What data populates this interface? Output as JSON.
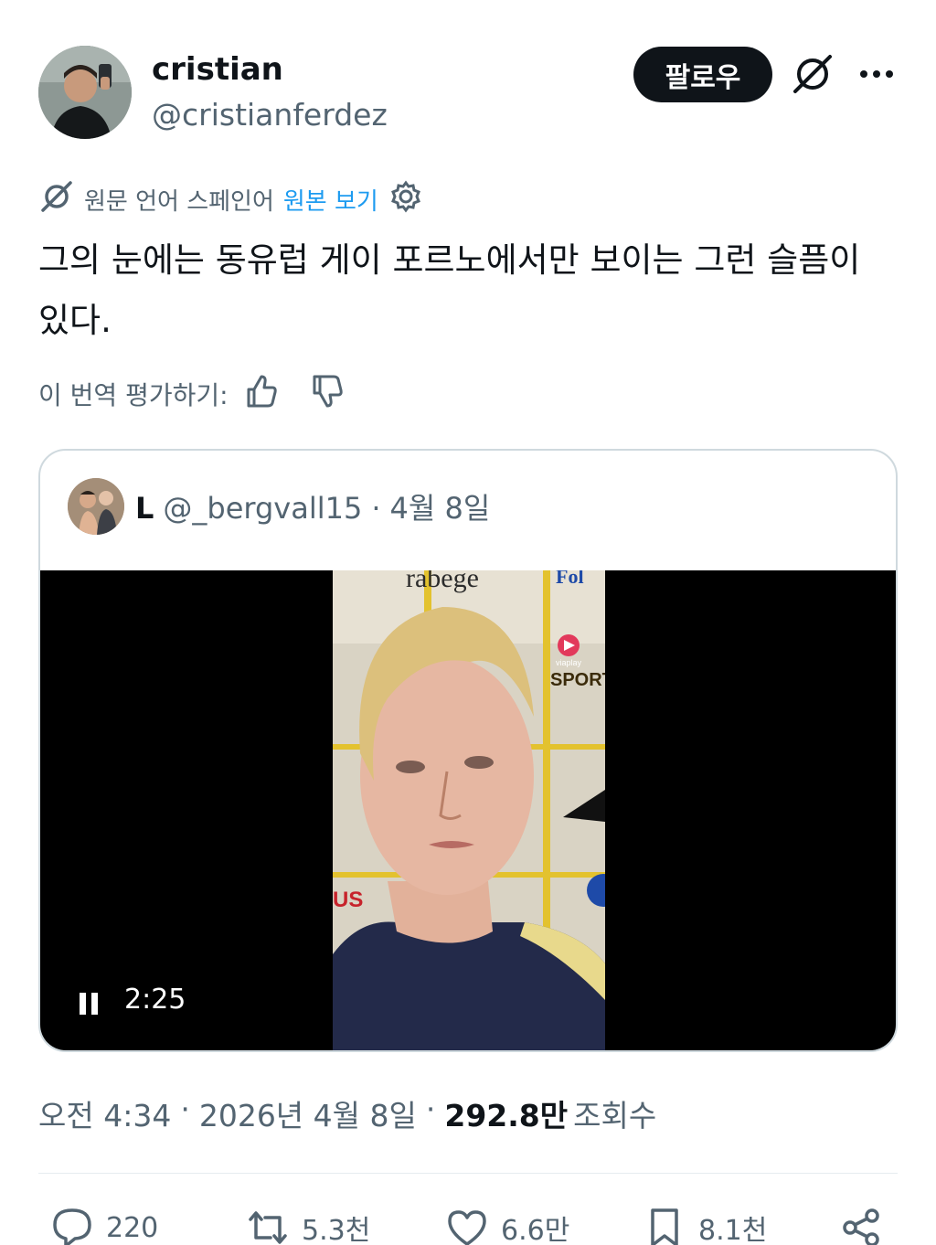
{
  "author": {
    "display_name": "cristian",
    "handle": "@cristianferdez",
    "follow_label": "팔로우"
  },
  "translation": {
    "notice": "원문 언어 스페인어",
    "view_original": "원본 보기"
  },
  "tweet": {
    "text": "그의 눈에는 동유럽 게이 포르노에서만 보이는 그런 슬픔이 있다."
  },
  "rating": {
    "label": "이 번역 평가하기:"
  },
  "quote": {
    "name": "L",
    "handle": "@_bergvall15",
    "separator": "·",
    "date": "4월 8일",
    "video_time": "2:25",
    "video_overlay": {
      "backdrop_text_1": "rabege",
      "backdrop_text_2": "Fol",
      "sponsor_small": "viaplay",
      "sponsor_large": "SPORT",
      "backdrop_text_3": "US"
    }
  },
  "meta": {
    "time": "오전 4:34",
    "sep1": "·",
    "date": "2026년 4월 8일",
    "sep2": "·",
    "views_count": "292.8만",
    "views_label": "조회수"
  },
  "actions": {
    "replies": "220",
    "reposts": "5.3천",
    "likes": "6.6만",
    "bookmarks": "8.1천"
  },
  "icons": [
    "grok-icon",
    "more-icon",
    "translate-icon",
    "settings-icon",
    "thumbs-up-icon",
    "thumbs-down-icon",
    "pause-icon",
    "reply-icon",
    "repost-icon",
    "like-icon",
    "bookmark-icon",
    "share-icon"
  ],
  "colors": {
    "text": "#0f1419",
    "muted": "#536471",
    "link": "#1d9bf0",
    "border": "#cfd9de",
    "follow_bg": "#0f1419"
  }
}
